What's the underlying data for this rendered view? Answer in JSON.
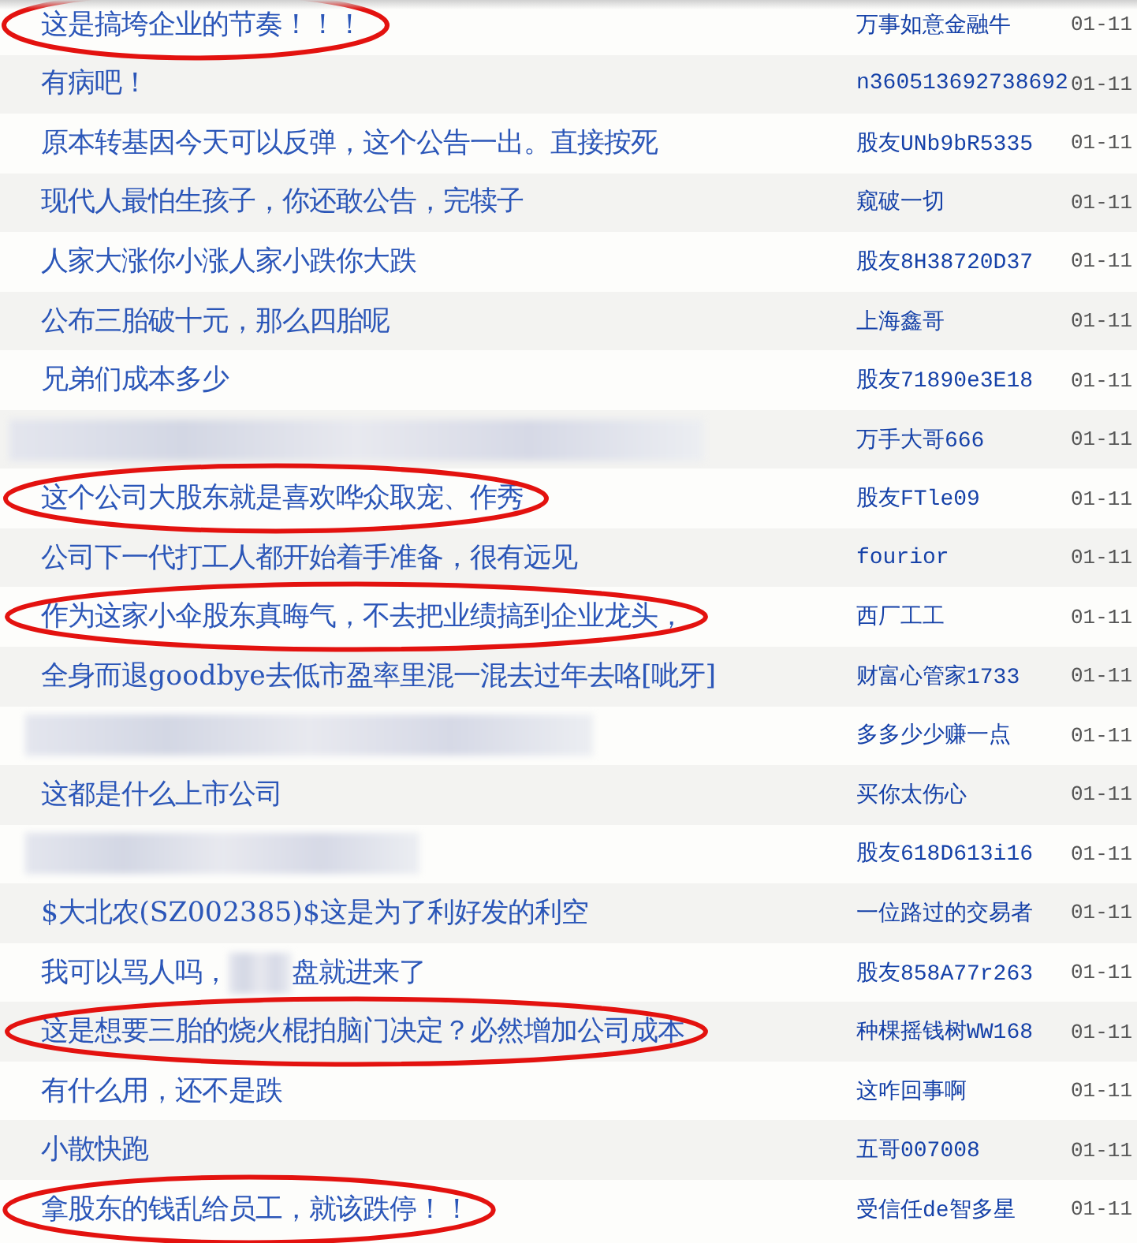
{
  "posts": [
    {
      "kind": "normal",
      "title": "这是搞垮企业的节奏！！！",
      "author": "万事如意金融牛",
      "date": "01-11",
      "circled": true
    },
    {
      "kind": "normal",
      "title": "有病吧！",
      "author": "n360513692738692",
      "date": "01-11",
      "circled": false
    },
    {
      "kind": "normal",
      "title": "原本转基因今天可以反弹，这个公告一出。直接按死",
      "author": "股友UNb9bR5335",
      "date": "01-11",
      "circled": false
    },
    {
      "kind": "normal",
      "title": "现代人最怕生孩子，你还敢公告，完犊子",
      "author": "窥破一切",
      "date": "01-11",
      "circled": false
    },
    {
      "kind": "normal",
      "title": "人家大涨你小涨人家小跌你大跌",
      "author": "股友8H38720D37",
      "date": "01-11",
      "circled": false
    },
    {
      "kind": "normal",
      "title": "公布三胎破十元，那么四胎呢",
      "author": "上海鑫哥",
      "date": "01-11",
      "circled": false
    },
    {
      "kind": "normal",
      "title": "兄弟们成本多少",
      "author": "股友71890e3E18",
      "date": "01-11",
      "circled": false
    },
    {
      "kind": "redacted",
      "author": "万手大哥666",
      "date": "01-11",
      "circled": false
    },
    {
      "kind": "normal",
      "title": "这个公司大股东就是喜欢哗众取宠、作秀",
      "author": "股友FTle09",
      "date": "01-11",
      "circled": true
    },
    {
      "kind": "normal",
      "title": "公司下一代打工人都开始着手准备，很有远见",
      "author": "fourior",
      "date": "01-11",
      "circled": false
    },
    {
      "kind": "normal",
      "title": "作为这家小伞股东真晦气，不去把业绩搞到企业龙头，",
      "author": "西厂工工",
      "date": "01-11",
      "circled": true
    },
    {
      "kind": "normal",
      "title": "全身而退goodbye去低市盈率里混一混去过年去咯[呲牙]",
      "author": "财富心管家1733",
      "date": "01-11",
      "circled": false
    },
    {
      "kind": "redacted",
      "author": "多多少少赚一点",
      "date": "01-11",
      "circled": false
    },
    {
      "kind": "normal",
      "title": "这都是什么上市公司",
      "author": "买你太伤心",
      "date": "01-11",
      "circled": false
    },
    {
      "kind": "redacted",
      "author": "股友618D613i16",
      "date": "01-11",
      "circled": false
    },
    {
      "kind": "normal",
      "title": "$大北农(SZ002385)$这是为了利好发的利空",
      "author": "一位路过的交易者",
      "date": "01-11",
      "circled": false
    },
    {
      "kind": "partial",
      "title": "我可以骂人吗，",
      "title_end": "盘就进来了",
      "author": "股友858A77r263",
      "date": "01-11",
      "circled": false
    },
    {
      "kind": "normal",
      "title": "这是想要三胎的烧火棍拍脑门决定？必然增加公司成本",
      "author": "种棵摇钱树WW168",
      "date": "01-11",
      "circled": true
    },
    {
      "kind": "normal",
      "title": "有什么用，还不是跌",
      "author": "这咋回事啊",
      "date": "01-11",
      "circled": false
    },
    {
      "kind": "normal",
      "title": "小散快跑",
      "author": "五哥007008",
      "date": "01-11",
      "circled": false
    },
    {
      "kind": "normal",
      "title": "拿股东的钱乱给员工，就该跌停！！",
      "author": "受信任de智多星",
      "date": "01-11",
      "circled": true
    }
  ]
}
